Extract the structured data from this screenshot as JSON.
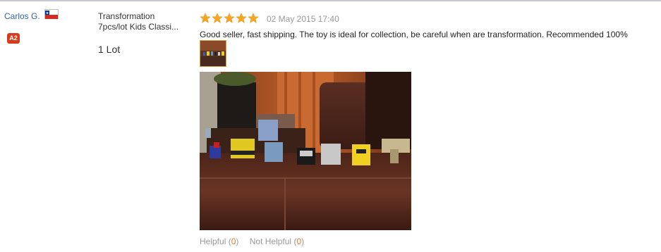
{
  "reviewer": {
    "name": "Carlos G.",
    "country_flag": "chile-flag-icon",
    "level_badge": "A2",
    "badge_color": "#d63c1c"
  },
  "product": {
    "title_line1": "Transformation",
    "title_line2": "7pcs/lot Kids Classi...",
    "quantity": "1 Lot"
  },
  "review": {
    "rating": 5,
    "rating_max": 5,
    "star_color": "#f5a623",
    "date": "02 May 2015 17:40",
    "text": "Good seller, fast shipping. The toy is ideal for collection, be careful when are transformation. Recommended 100%",
    "photo_icon": "review-photo-thumbnail"
  },
  "feedback": {
    "helpful_label": "Helpful",
    "helpful_count": "0",
    "not_helpful_label": "Not Helpful",
    "not_helpful_count": "0"
  }
}
